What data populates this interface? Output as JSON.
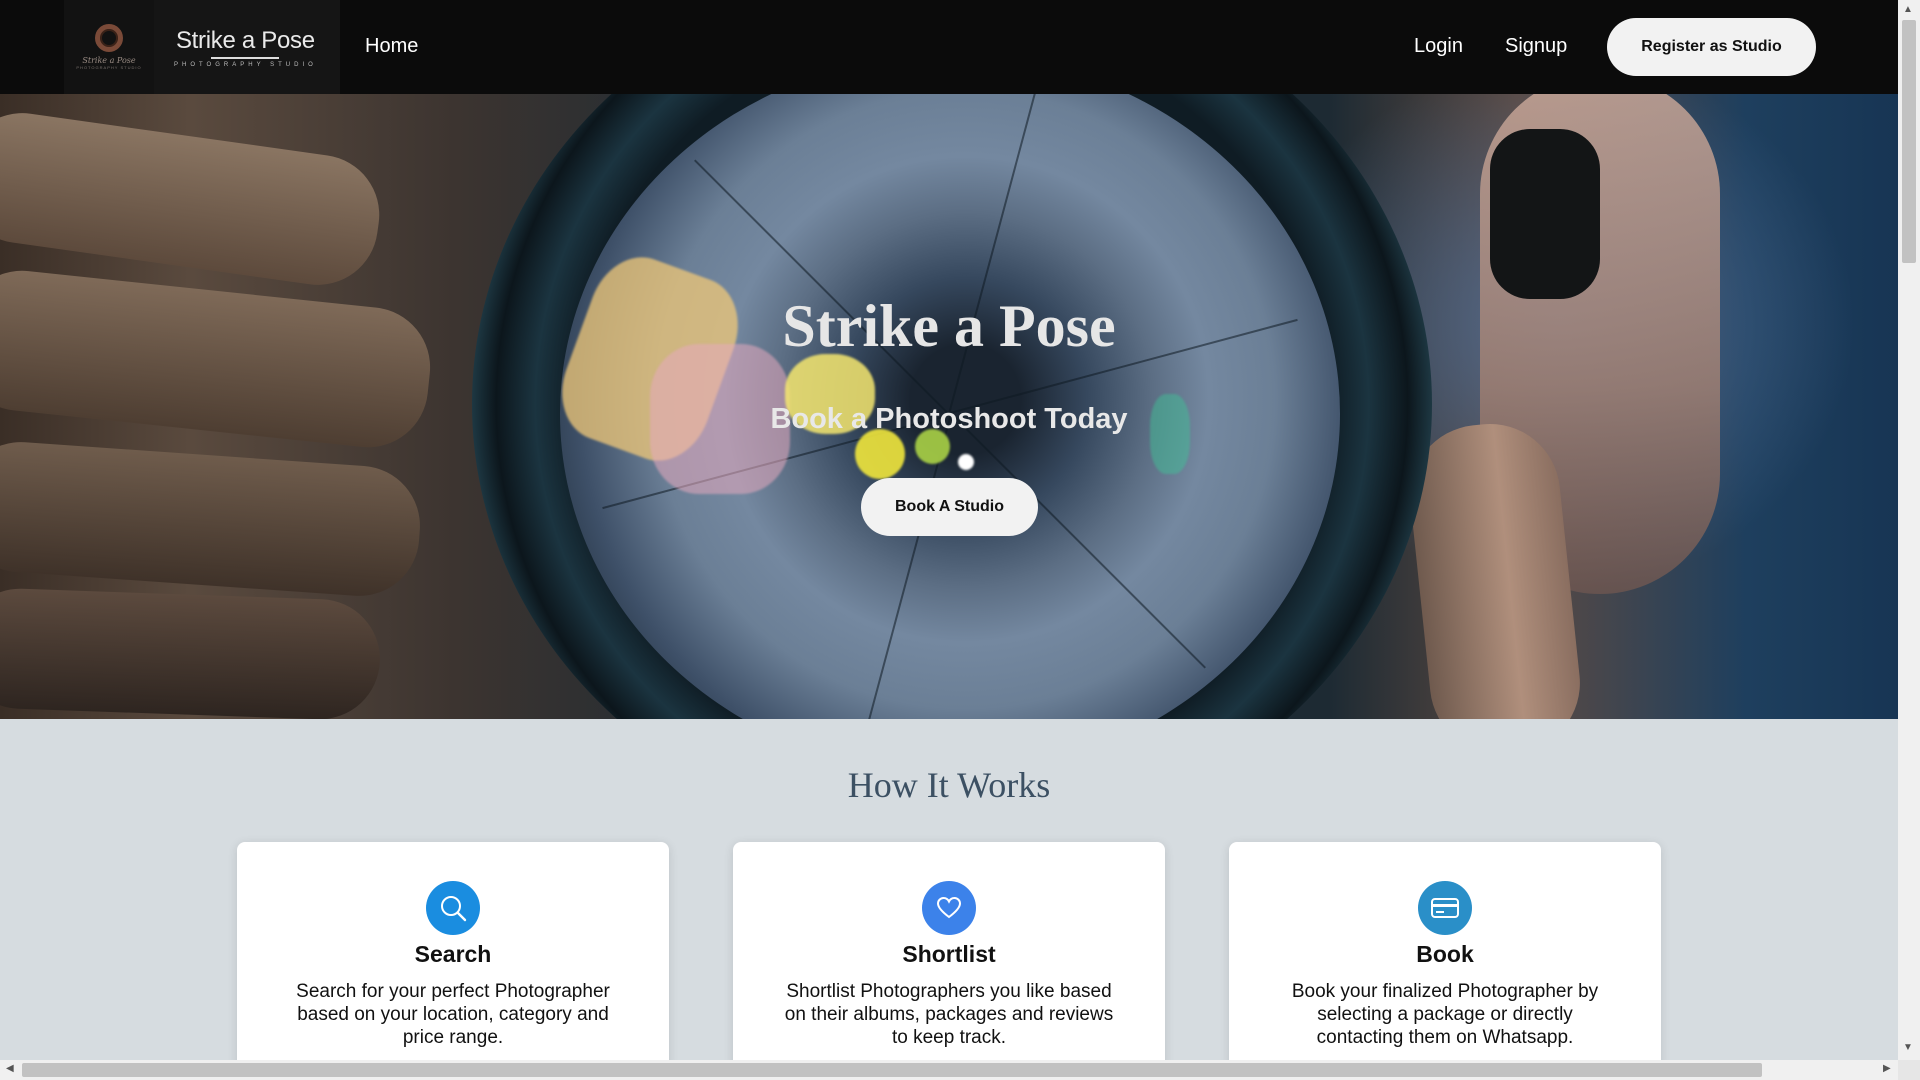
{
  "navbar": {
    "logo_script": "Strike a Pose",
    "logo_small_caption": "PHOTOGRAPHY STUDIO",
    "brand_name": "Strike a Pose",
    "brand_tagline": "PHOTOGRAPHY STUDIO",
    "home_label": "Home",
    "login_label": "Login",
    "signup_label": "Signup",
    "register_label": "Register as Studio"
  },
  "hero": {
    "title": "Strike a Pose",
    "subtitle": "Book a Photoshoot Today",
    "button_label": "Book A Studio"
  },
  "how_it_works": {
    "title": "How It Works",
    "cards": [
      {
        "icon": "search-icon",
        "icon_color": "#1a8de0",
        "title": "Search",
        "description": "Search for your perfect Photographer based on your location, category and price range."
      },
      {
        "icon": "heart-icon",
        "icon_color": "#3c82ea",
        "title": "Shortlist",
        "description": "Shortlist Photographers you like based on their albums, packages and reviews to keep track."
      },
      {
        "icon": "credit-card-icon",
        "icon_color": "#2a8fc8",
        "title": "Book",
        "description": "Book your finalized Photographer by selecting a package or directly contacting them on Whatsapp."
      }
    ]
  },
  "colors": {
    "navbar_bg": "#0b0b0b",
    "section_bg": "#d6dce0",
    "heading_color": "#3c5063"
  }
}
